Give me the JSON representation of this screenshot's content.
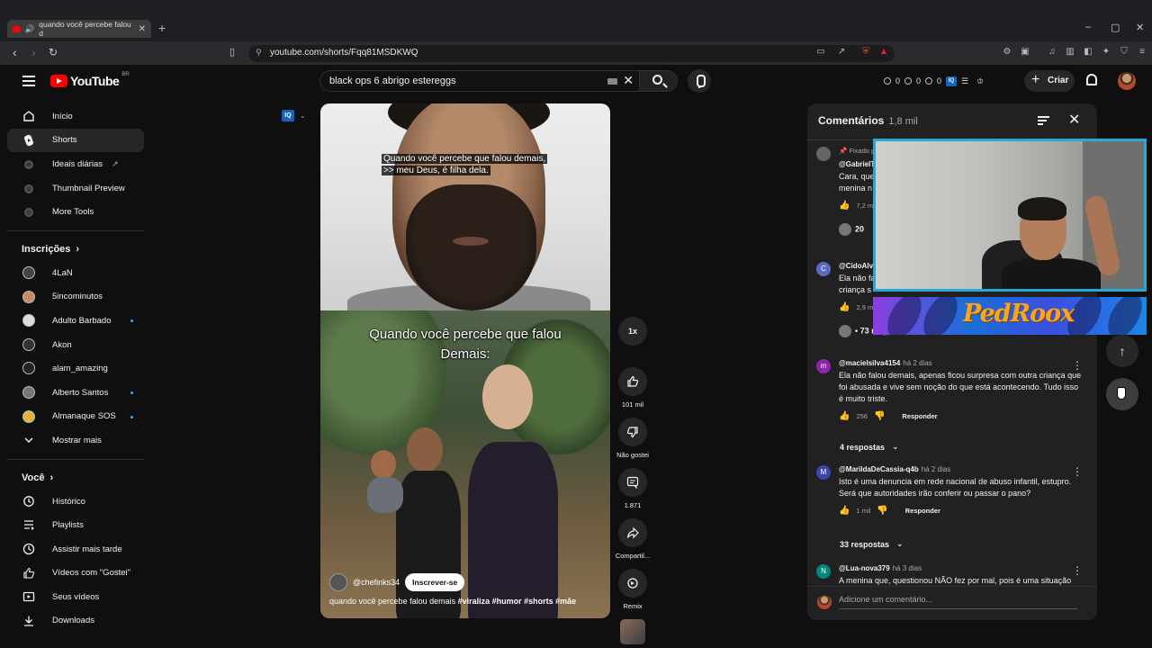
{
  "browser": {
    "tab_title": "quando você percebe falou d",
    "url": "youtube.com/shorts/Fqq81MSDKWQ"
  },
  "header": {
    "logo_text": "YouTube",
    "country_code": "BR",
    "search_value": "black ops 6 abrigo estereggs",
    "stats": [
      "0",
      "0",
      "0"
    ],
    "stats_badge": "IQ",
    "create_label": "Criar"
  },
  "sidebar": {
    "main": [
      {
        "label": "Início",
        "icon": "home-icon"
      },
      {
        "label": "Shorts",
        "icon": "shorts-icon"
      },
      {
        "label": "Ideais diárias",
        "icon": "ideas-icon"
      },
      {
        "label": "Thumbnail Preview",
        "icon": "thumbnail-icon"
      },
      {
        "label": "More Tools",
        "icon": "tools-icon"
      }
    ],
    "subscriptions_title": "Inscrições",
    "subscriptions": [
      {
        "label": "4LaN"
      },
      {
        "label": "5incominutos"
      },
      {
        "label": "Adulto Barbado"
      },
      {
        "label": "Akon"
      },
      {
        "label": "alam_amazing"
      },
      {
        "label": "Alberto Santos"
      },
      {
        "label": "Almanaque SOS"
      }
    ],
    "show_more": "Mostrar mais",
    "you_title": "Você",
    "you": [
      {
        "label": "Histórico",
        "icon": "history-icon"
      },
      {
        "label": "Playlists",
        "icon": "playlists-icon"
      },
      {
        "label": "Assistir mais tarde",
        "icon": "watch-later-icon"
      },
      {
        "label": "Vídeos com \"Gostei\"",
        "icon": "liked-icon"
      },
      {
        "label": "Seus vídeos",
        "icon": "your-videos-icon"
      },
      {
        "label": "Downloads",
        "icon": "downloads-icon"
      }
    ]
  },
  "video": {
    "iq_badge": "IQ",
    "top_caption_line1": "Quando você percebe que falou demais,",
    "top_caption_line2": ">> meu Deus, é filha dela.",
    "overlay_line1": "Quando você percebe que falou",
    "overlay_line2": "Demais:",
    "channel": "@chefinks34",
    "subscribe_label": "Inscrever-se",
    "title_text": "quando você percebe falou demais ",
    "title_tags": "#viraliza #humor #shorts #mãe"
  },
  "actions": {
    "speed": "1x",
    "likes": "101 mil",
    "dislike_label": "Não gostei",
    "comments": "1.871",
    "share_label": "Compartil...",
    "remix_label": "Remix"
  },
  "comments": {
    "title": "Comentários",
    "count": "1,8 mil",
    "pinned_label": "Fixado p",
    "items": [
      {
        "author": "@GabrielT",
        "time": "",
        "text": "Cara, que",
        "text2": "menina n",
        "likes": "7,2 mi",
        "replies_label": "20"
      },
      {
        "author": "@CidoAlv",
        "time": "",
        "text": "Ela não fa",
        "text2": "criança s",
        "likes": "2,9 mi",
        "replies_label": "73 respostas"
      },
      {
        "author": "@macielsilva4154",
        "time": "há 2 dias",
        "text": "Ela não falou demais,  apenas ficou surpresa com outra criança que foi abusada e vive sem noção do que está acontecendo. Tudo isso é muito triste.",
        "likes": "256",
        "reply": "Responder",
        "replies_label": "4 respostas"
      },
      {
        "author": "@MarildaDeCassia-q4b",
        "time": "há 2 dias",
        "text": "Isto é uma denuncia em rede nacional de abuso infantil, estupro. Será que autoridades irão conferir ou passar o pano?",
        "likes": "1 mil",
        "reply": "Responder",
        "replies_label": "33 respostas"
      },
      {
        "author": "@Lua-nova379",
        "time": "há 3 dias",
        "text": "A menina que, questionou NÃO fez por mal, pois é uma situação"
      }
    ],
    "add_placeholder": "Adicione um comentário..."
  },
  "overlay": {
    "brand_text": "PedRoox"
  },
  "colors": {
    "accent": "#3ea6ff",
    "cam_border": "#2aa7d6",
    "brand_orange": "#f5a623",
    "yt_red": "#ff0000"
  }
}
